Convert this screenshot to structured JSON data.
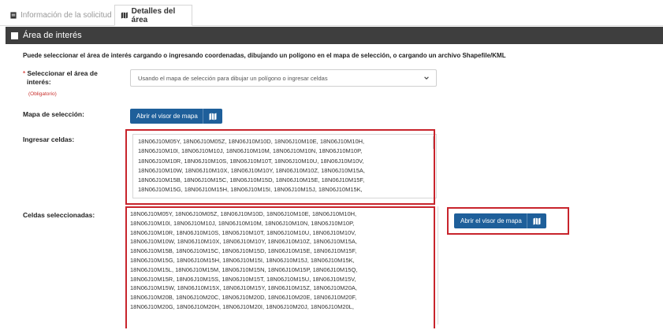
{
  "tabs": [
    {
      "label": "Información de la solicitud",
      "icon": "file-icon"
    },
    {
      "label": "Detalles del área",
      "icon": "map-icon"
    }
  ],
  "section": {
    "title": "Área de interés",
    "icon": "checkbox-icon"
  },
  "intro_text": "Puede seleccionar el área de interés cargando o ingresando coordenadas, dibujando un polígono en el mapa de selección, o cargando un archivo Shapefile/KML",
  "area_select": {
    "label_line1": "Seleccionar el área de",
    "label_line2": "interés:",
    "required_marker": "*",
    "required_text": "(Obligatorio)",
    "value": "Usando el mapa de selección para dibujar un polígono o ingresar celdas"
  },
  "map_selection": {
    "label": "Mapa de selección:",
    "button_label": "Abrir el visor de mapa",
    "icon": "map-icon"
  },
  "enter_cells": {
    "label": "Ingresar celdas:",
    "lines": [
      "18N06J10M05Y, 18N06J10M05Z, 18N06J10M10D, 18N06J10M10E, 18N06J10M10H,",
      "18N06J10M10I, 18N06J10M10J, 18N06J10M10M, 18N06J10M10N, 18N06J10M10P,",
      "18N06J10M10R, 18N06J10M10S, 18N06J10M10T, 18N06J10M10U, 18N06J10M10V,",
      "18N06J10M10W, 18N06J10M10X, 18N06J10M10Y, 18N06J10M10Z, 18N06J10M15A,",
      "18N06J10M15B, 18N06J10M15C, 18N06J10M15D, 18N06J10M15E, 18N06J10M15F,",
      "18N06J10M15G, 18N06J10M15H, 18N06J10M15I, 18N06J10M15J, 18N06J10M15K,"
    ]
  },
  "selected_cells": {
    "label": "Celdas seleccionadas:",
    "button_label": "Abrir el visor de mapa",
    "icon": "map-icon",
    "lines": [
      "18N06J10M05Y, 18N06J10M05Z, 18N06J10M10D, 18N06J10M10E, 18N06J10M10H,",
      "18N06J10M10I, 18N06J10M10J, 18N06J10M10M, 18N06J10M10N, 18N06J10M10P,",
      "18N06J10M10R, 18N06J10M10S, 18N06J10M10T, 18N06J10M10U, 18N06J10M10V,",
      "18N06J10M10W, 18N06J10M10X, 18N06J10M10Y, 18N06J10M10Z, 18N06J10M15A,",
      "18N06J10M15B, 18N06J10M15C, 18N06J10M15D, 18N06J10M15E, 18N06J10M15F,",
      "18N06J10M15G, 18N06J10M15H, 18N06J10M15I, 18N06J10M15J, 18N06J10M15K,",
      "18N06J10M15L, 18N06J10M15M, 18N06J10M15N, 18N06J10M15P, 18N06J10M15Q,",
      "18N06J10M15R, 18N06J10M15S, 18N06J10M15T, 18N06J10M15U, 18N06J10M15V,",
      "18N06J10M15W, 18N06J10M15X, 18N06J10M15Y, 18N06J10M15Z, 18N06J10M20A,",
      "18N06J10M20B, 18N06J10M20C, 18N06J10M20D, 18N06J10M20E, 18N06J10M20F,",
      "18N06J10M20G, 18N06J10M20H, 18N06J10M20I, 18N06J10M20J, 18N06J10M20L,"
    ]
  },
  "colors": {
    "header_bg": "#3e3e3e",
    "button_bg": "#1e5f9a",
    "highlight_border": "#c8242c",
    "required": "#c9302c"
  }
}
